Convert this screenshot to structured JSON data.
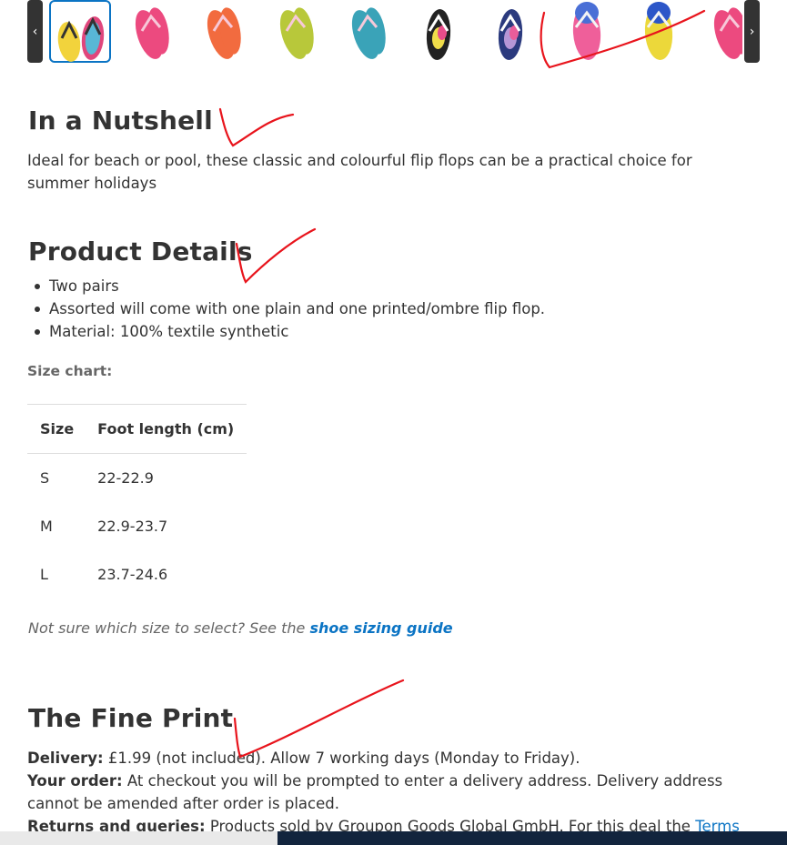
{
  "carousel": {
    "prev_symbol": "‹",
    "next_symbol": "›",
    "thumbnails": [
      {
        "name": "multipack-mixed",
        "selected": true,
        "colors": [
          "#f2d33c",
          "#333333",
          "#e0467c",
          "#58b7d6"
        ]
      },
      {
        "name": "pink",
        "selected": false,
        "colors": [
          "#ec4a7f"
        ]
      },
      {
        "name": "orange",
        "selected": false,
        "colors": [
          "#f26b3f"
        ]
      },
      {
        "name": "lime",
        "selected": false,
        "colors": [
          "#b8c83a"
        ]
      },
      {
        "name": "teal",
        "selected": false,
        "colors": [
          "#3aa3b8"
        ]
      },
      {
        "name": "striped-floral",
        "selected": false,
        "colors": [
          "#222222",
          "#f0dd4a",
          "#e84d8a"
        ]
      },
      {
        "name": "navy-floral",
        "selected": false,
        "colors": [
          "#2b3a7e",
          "#b596d6",
          "#e85d9a"
        ]
      },
      {
        "name": "pink-ombre",
        "selected": false,
        "colors": [
          "#4a6fd6",
          "#ef5f9a"
        ]
      },
      {
        "name": "yellow-ombre",
        "selected": false,
        "colors": [
          "#2c56c8",
          "#ecd83a"
        ]
      },
      {
        "name": "pink-partial",
        "selected": false,
        "colors": [
          "#ec4a7f"
        ]
      }
    ]
  },
  "nutshell": {
    "title": "In a Nutshell",
    "text": "Ideal for beach or pool, these classic and colourful flip flops can be a practical choice for summer holidays"
  },
  "details": {
    "title": "Product Details",
    "bullets": [
      "Two pairs",
      "Assorted will come with one plain and one printed/ombre flip flop.",
      "Material: 100% textile synthetic"
    ],
    "size_chart_label": "Size chart:",
    "table": {
      "headers": [
        "Size",
        "Foot length (cm)"
      ],
      "rows": [
        [
          "S",
          "22-22.9"
        ],
        [
          "M",
          "22.9-23.7"
        ],
        [
          "L",
          "23.7-24.6"
        ]
      ]
    },
    "sizing_note": "Not sure which size to select? See the ",
    "sizing_link": "shoe sizing guide"
  },
  "fine_print": {
    "title": "The Fine Print",
    "delivery_label": "Delivery:",
    "delivery_text": " £1.99 (not included). Allow 7 working days (Monday to Friday).",
    "order_label": "Your order:",
    "order_text": " At checkout you will be prompted to enter a delivery address. Delivery address cannot be amended after order is placed.",
    "returns_label": "Returns and queries:",
    "returns_text": " Products sold by Groupon Goods Global GmbH. For this deal the ",
    "returns_link": "Terms of"
  },
  "colors": {
    "text": "#333333",
    "muted": "#666666",
    "link": "#0b74c4",
    "annotation": "#e8141c"
  }
}
